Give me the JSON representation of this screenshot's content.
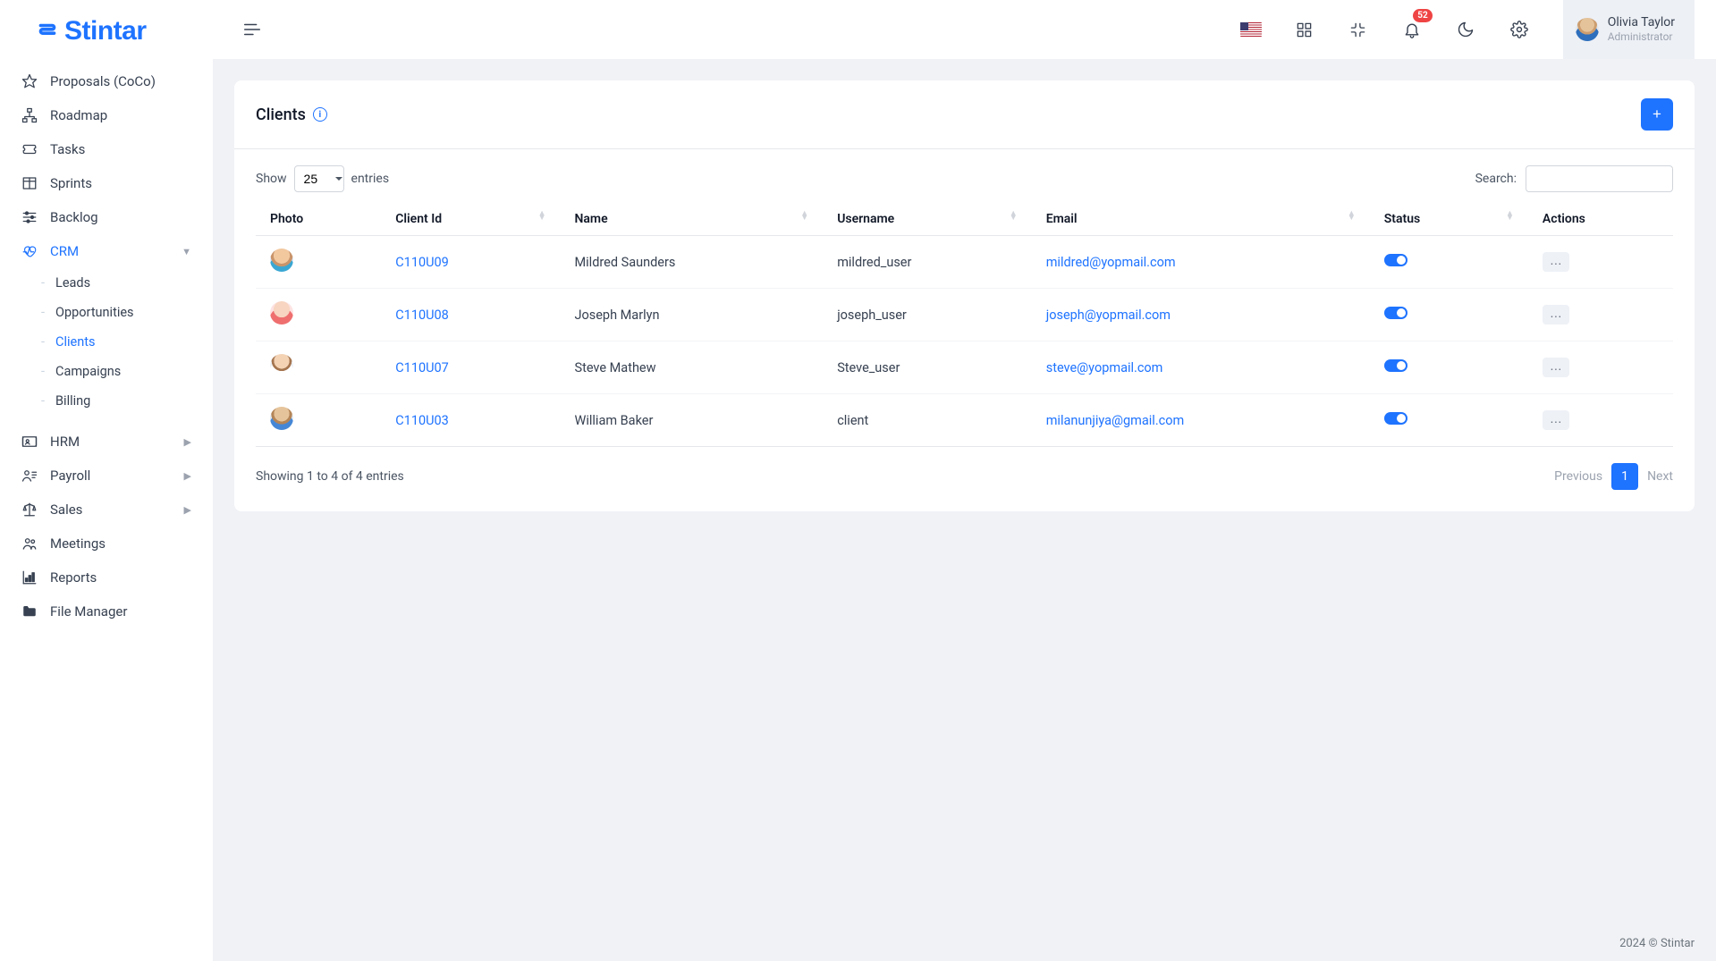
{
  "brand": "Stintar",
  "header": {
    "notification_count": "52",
    "user_name": "Olivia Taylor",
    "user_role": "Administrator"
  },
  "sidebar": {
    "items": [
      {
        "label": "Proposals (CoCo)",
        "icon": "star"
      },
      {
        "label": "Roadmap",
        "icon": "sitemap"
      },
      {
        "label": "Tasks",
        "icon": "ticket"
      },
      {
        "label": "Sprints",
        "icon": "columns"
      },
      {
        "label": "Backlog",
        "icon": "sliders"
      },
      {
        "label": "CRM",
        "icon": "heart",
        "active": true,
        "chevron": "down",
        "sub": [
          {
            "label": "Leads"
          },
          {
            "label": "Opportunities"
          },
          {
            "label": "Clients",
            "active": true
          },
          {
            "label": "Campaigns"
          },
          {
            "label": "Billing"
          }
        ]
      },
      {
        "label": "HRM",
        "icon": "id",
        "chevron": "right"
      },
      {
        "label": "Payroll",
        "icon": "userlines",
        "chevron": "right"
      },
      {
        "label": "Sales",
        "icon": "scale",
        "chevron": "right"
      },
      {
        "label": "Meetings",
        "icon": "group"
      },
      {
        "label": "Reports",
        "icon": "chart"
      },
      {
        "label": "File Manager",
        "icon": "folder"
      }
    ]
  },
  "page": {
    "title": "Clients",
    "add_label": "+",
    "show_label": "Show",
    "entries_label": "entries",
    "page_size": "25",
    "search_label": "Search:",
    "columns": [
      "Photo",
      "Client Id",
      "Name",
      "Username",
      "Email",
      "Status",
      "Actions"
    ],
    "rows": [
      {
        "avatar": "avatar1",
        "client_id": "C110U09",
        "name": "Mildred Saunders",
        "username": "mildred_user",
        "email": "mildred@yopmail.com",
        "status": true
      },
      {
        "avatar": "avatar2",
        "client_id": "C110U08",
        "name": "Joseph Marlyn",
        "username": "joseph_user",
        "email": "joseph@yopmail.com",
        "status": true
      },
      {
        "avatar": "avatar3",
        "client_id": "C110U07",
        "name": "Steve Mathew",
        "username": "Steve_user",
        "email": "steve@yopmail.com",
        "status": true
      },
      {
        "avatar": "avatar4",
        "client_id": "C110U03",
        "name": "William Baker",
        "username": "client",
        "email": "milanunjiya@gmail.com",
        "status": true
      }
    ],
    "info_text": "Showing 1 to 4 of 4 entries",
    "pagination": {
      "prev": "Previous",
      "pages": [
        "1"
      ],
      "next": "Next"
    }
  },
  "footer": "2024 © Stintar"
}
